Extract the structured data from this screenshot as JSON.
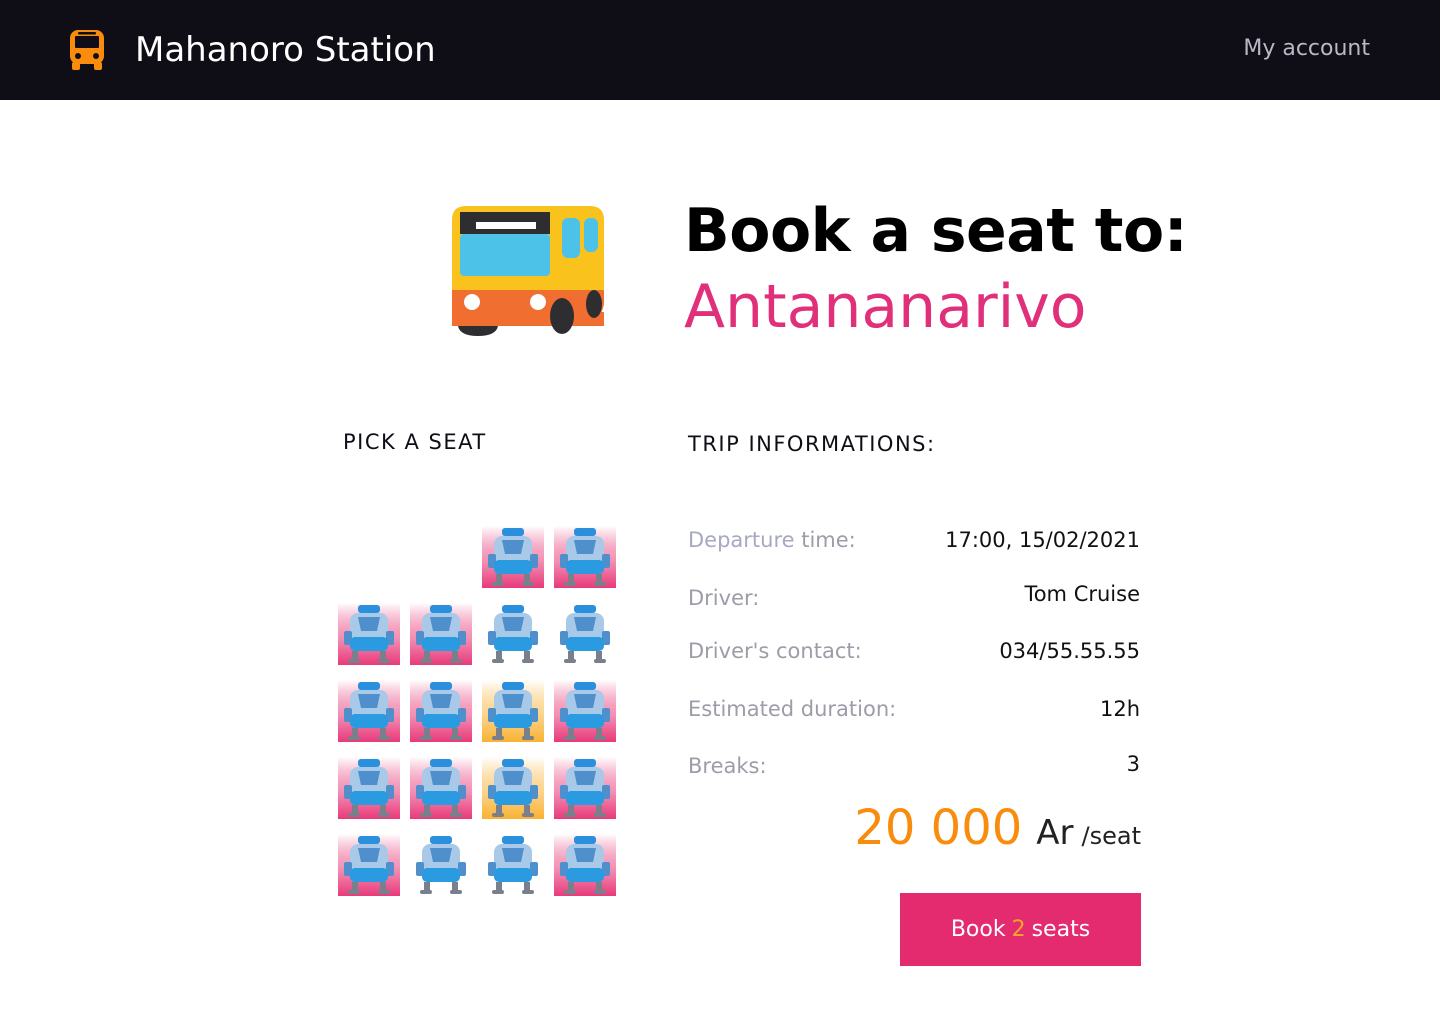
{
  "header": {
    "brand_name": "Mahanoro Station",
    "brand_icon": "bus-icon",
    "account_link": "My account"
  },
  "hero": {
    "icon": "bus-icon",
    "title": "Book a seat to:",
    "destination": "Antananarivo"
  },
  "seat_picker": {
    "label": "PICK A SEAT",
    "seats": [
      {
        "row": 0,
        "col": 2,
        "state": "booked"
      },
      {
        "row": 0,
        "col": 3,
        "state": "booked"
      },
      {
        "row": 1,
        "col": 0,
        "state": "booked"
      },
      {
        "row": 1,
        "col": 1,
        "state": "booked"
      },
      {
        "row": 1,
        "col": 2,
        "state": "available"
      },
      {
        "row": 1,
        "col": 3,
        "state": "available"
      },
      {
        "row": 2,
        "col": 0,
        "state": "booked"
      },
      {
        "row": 2,
        "col": 1,
        "state": "booked"
      },
      {
        "row": 2,
        "col": 2,
        "state": "selected"
      },
      {
        "row": 2,
        "col": 3,
        "state": "booked"
      },
      {
        "row": 3,
        "col": 0,
        "state": "booked"
      },
      {
        "row": 3,
        "col": 1,
        "state": "booked"
      },
      {
        "row": 3,
        "col": 2,
        "state": "selected"
      },
      {
        "row": 3,
        "col": 3,
        "state": "booked"
      },
      {
        "row": 4,
        "col": 0,
        "state": "booked"
      },
      {
        "row": 4,
        "col": 1,
        "state": "available"
      },
      {
        "row": 4,
        "col": 2,
        "state": "available"
      },
      {
        "row": 4,
        "col": 3,
        "state": "booked"
      }
    ],
    "colors": {
      "booked": "#e83a7a",
      "selected": "#f9b233",
      "available": "#ffffff"
    }
  },
  "trip": {
    "label": "TRIP INFORMATIONS:",
    "departure_label_accent": "Departure",
    "departure_label_rest": " time:",
    "departure_value": "17:00, 15/02/2021",
    "driver_label": "Driver:",
    "driver_value": "Tom Cruise",
    "contact_label": "Driver's contact:",
    "contact_value": "034/55.55.55",
    "duration_label": "Estimated duration:",
    "duration_value": "12h",
    "breaks_label": "Breaks:",
    "breaks_value": "3"
  },
  "price": {
    "amount": "20 000",
    "currency": "Ar",
    "unit": "/seat"
  },
  "booking": {
    "button_prefix": "Book",
    "seat_count": "2",
    "button_suffix": "seats"
  },
  "colors": {
    "header_bg": "#0f0e17",
    "accent_pink": "#e42b6f",
    "accent_orange": "#f98c0d"
  }
}
